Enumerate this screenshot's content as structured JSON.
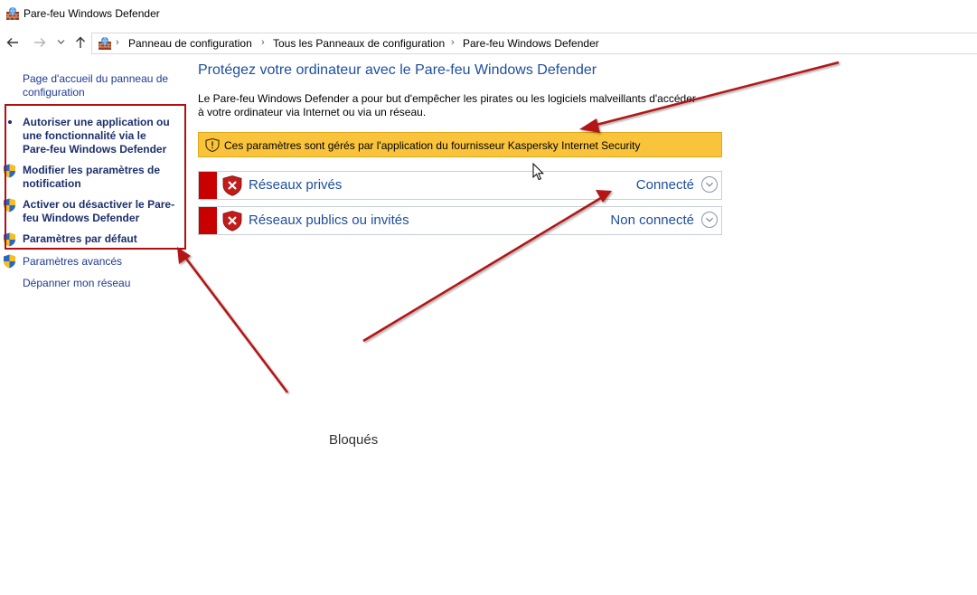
{
  "window": {
    "title": "Pare-feu Windows Defender"
  },
  "breadcrumb": [
    "Panneau de configuration",
    "Tous les Panneaux de configuration",
    "Pare-feu Windows Defender"
  ],
  "left_nav": {
    "home": "Page d'accueil du panneau de configuration",
    "items": [
      {
        "label": "Autoriser une application ou une fonctionnalité via le Pare-feu Windows Defender"
      },
      {
        "label": "Modifier les paramètres de notification"
      },
      {
        "label": "Activer ou désactiver le Pare-feu Windows Defender"
      },
      {
        "label": "Paramètres par défaut"
      },
      {
        "label": "Paramètres avancés"
      },
      {
        "label": "Dépanner mon réseau"
      }
    ]
  },
  "main": {
    "heading": "Protégez votre ordinateur avec le Pare-feu Windows Defender",
    "description": "Le Pare-feu Windows Defender a pour but d'empêcher les pirates ou les logiciels malveillants d'accéder à votre ordinateur via Internet ou via un réseau.",
    "warning": "Ces paramètres sont gérés par l'application du fournisseur Kaspersky Internet Security",
    "networks": [
      {
        "name": "Réseaux privés",
        "status": "Connecté"
      },
      {
        "name": "Réseaux publics ou invités",
        "status": "Non connecté"
      }
    ]
  },
  "annotation": {
    "caption": "Bloqués"
  },
  "colors": {
    "accent": "#1e4e9c",
    "warning": "#f9c33b",
    "blocked": "#c90000",
    "annotation": "#b01010"
  },
  "icons": [
    "firewall-icon",
    "back-arrow-icon",
    "forward-arrow-icon",
    "recent-dropdown-icon",
    "up-arrow-icon",
    "control-panel-icon",
    "uac-shield-icon",
    "warning-shield-icon",
    "blocked-shield-icon",
    "expand-chevron-icon",
    "mouse-cursor-icon"
  ]
}
